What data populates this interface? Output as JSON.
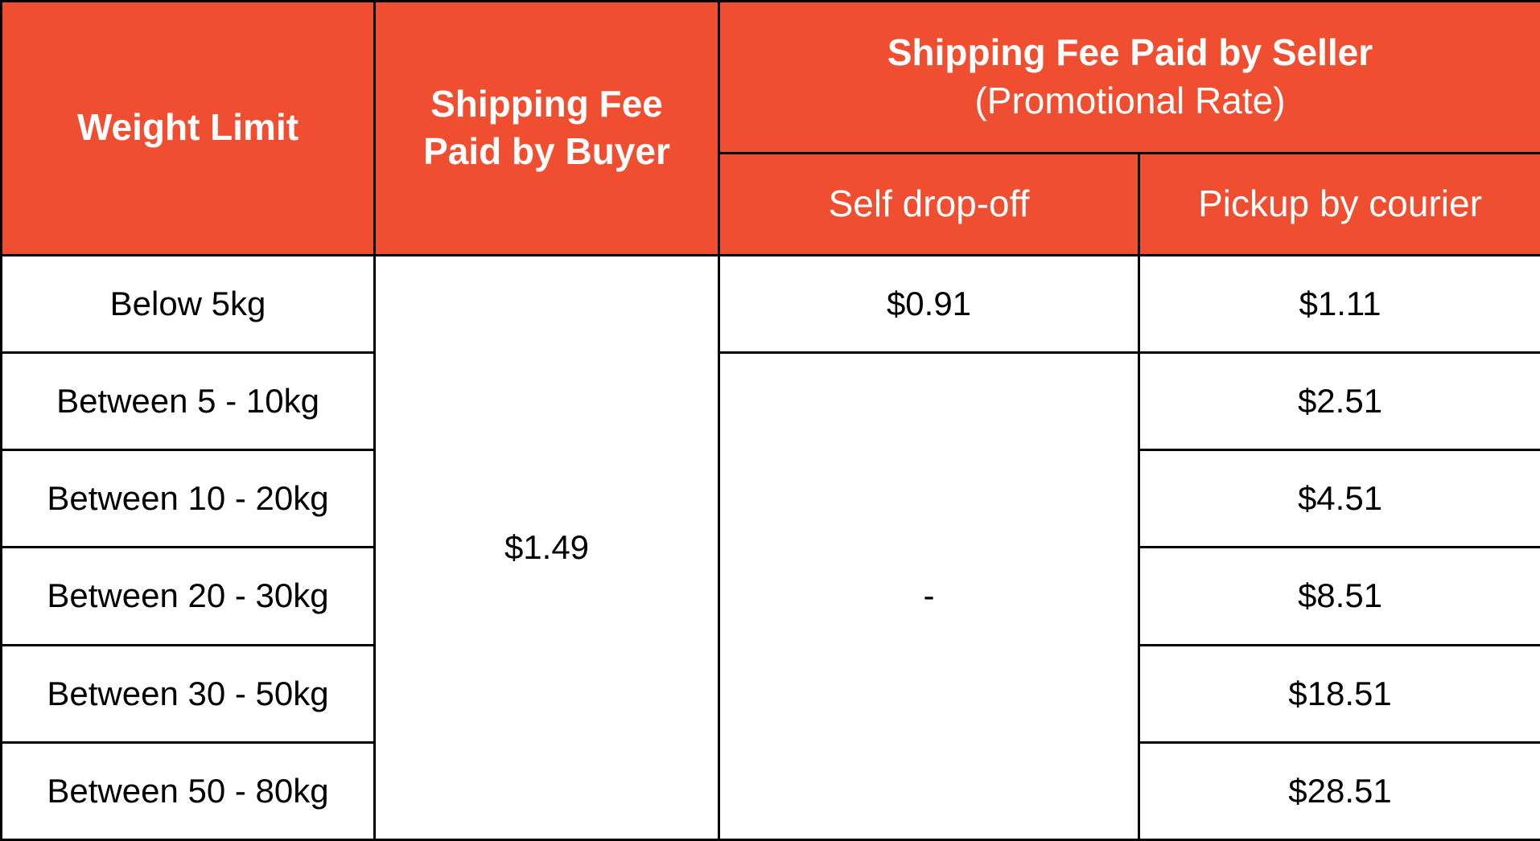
{
  "colors": {
    "header_bg": "#F04E30",
    "header_text": "#FFFFFF",
    "border": "#000000"
  },
  "headers": {
    "weight_limit": "Weight Limit",
    "buyer": "Shipping Fee Paid by Buyer",
    "seller": "Shipping Fee Paid by Seller",
    "seller_note": "(Promotional Rate)",
    "self_dropoff": "Self drop-off",
    "pickup": "Pickup by courier"
  },
  "buyer_fee": "$1.49",
  "self_dropoff_values": [
    "$0.91",
    "-"
  ],
  "rows": [
    {
      "weight": "Below 5kg",
      "pickup": "$1.11"
    },
    {
      "weight": "Between 5 - 10kg",
      "pickup": "$2.51"
    },
    {
      "weight": "Between 10 - 20kg",
      "pickup": "$4.51"
    },
    {
      "weight": "Between 20 - 30kg",
      "pickup": "$8.51"
    },
    {
      "weight": "Between 30 - 50kg",
      "pickup": "$18.51"
    },
    {
      "weight": "Between 50 - 80kg",
      "pickup": "$28.51"
    }
  ]
}
